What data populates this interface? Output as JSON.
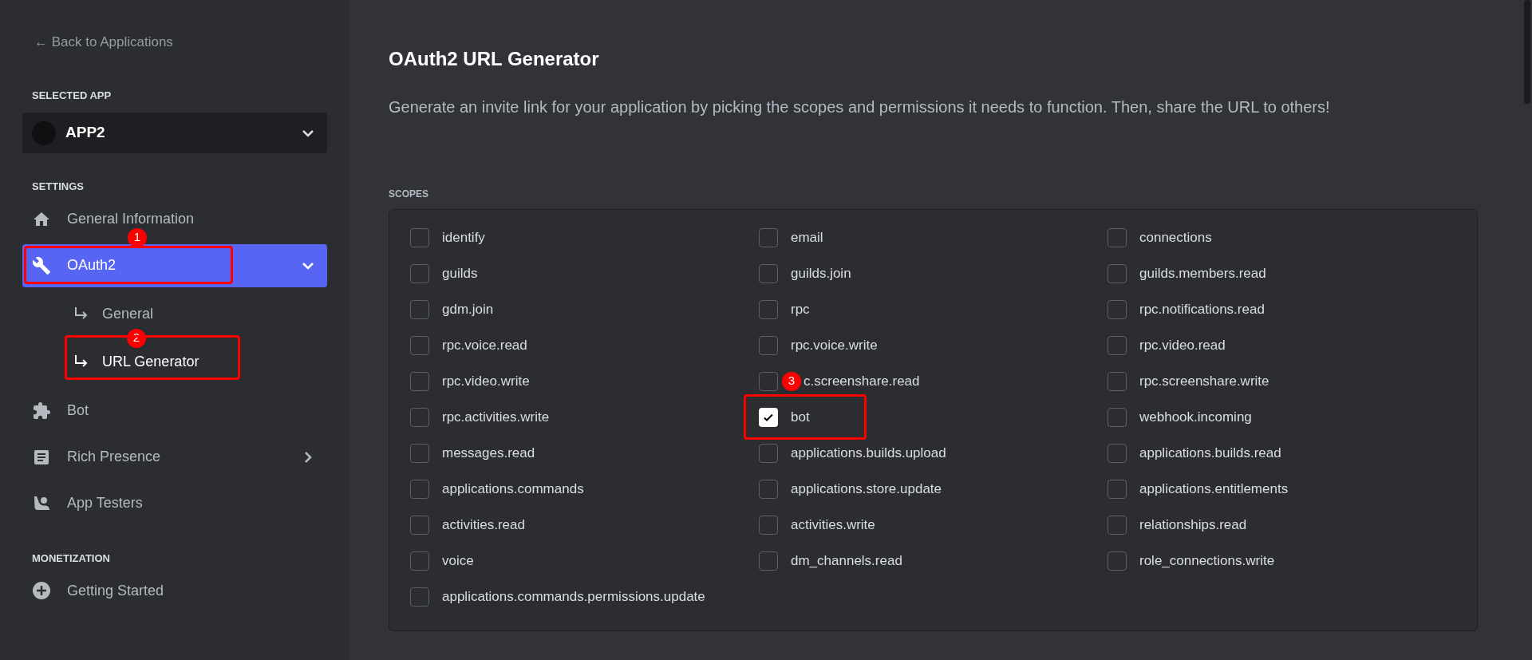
{
  "sidebar": {
    "back_link": "← Back to Applications",
    "selected_app": {
      "heading": "SELECTED APP",
      "name": "APP2"
    },
    "sections": [
      {
        "heading": "SETTINGS",
        "items": [
          {
            "label": "General Information",
            "selected": false
          },
          {
            "label": "OAuth2",
            "selected": true,
            "expanded": true,
            "marker": "1",
            "highlighted": true,
            "children": [
              {
                "label": "General",
                "selected": false
              },
              {
                "label": "URL Generator",
                "selected": true,
                "marker": "2",
                "highlighted": true
              }
            ]
          },
          {
            "label": "Bot",
            "selected": false
          },
          {
            "label": "Rich Presence",
            "selected": false,
            "expanded": false
          },
          {
            "label": "App Testers",
            "selected": false
          }
        ]
      },
      {
        "heading": "MONETIZATION",
        "items": [
          {
            "label": "Getting Started",
            "selected": false
          }
        ]
      }
    ]
  },
  "main": {
    "title": "OAuth2 URL Generator",
    "description": "Generate an invite link for your application by picking the scopes and permissions it needs to function. Then, share the URL to others!"
  },
  "scopes": {
    "heading": "SCOPES",
    "items": [
      {
        "label": "identify",
        "checked": false
      },
      {
        "label": "email",
        "checked": false
      },
      {
        "label": "connections",
        "checked": false
      },
      {
        "label": "guilds",
        "checked": false
      },
      {
        "label": "guilds.join",
        "checked": false
      },
      {
        "label": "guilds.members.read",
        "checked": false
      },
      {
        "label": "gdm.join",
        "checked": false
      },
      {
        "label": "rpc",
        "checked": false
      },
      {
        "label": "rpc.notifications.read",
        "checked": false
      },
      {
        "label": "rpc.voice.read",
        "checked": false
      },
      {
        "label": "rpc.voice.write",
        "checked": false
      },
      {
        "label": "rpc.video.read",
        "checked": false
      },
      {
        "label": "rpc.video.write",
        "checked": false
      },
      {
        "label": "c.screenshare.read",
        "checked": false,
        "marker": "3"
      },
      {
        "label": "rpc.screenshare.write",
        "checked": false
      },
      {
        "label": "rpc.activities.write",
        "checked": false
      },
      {
        "label": "bot",
        "checked": true,
        "highlighted": true
      },
      {
        "label": "webhook.incoming",
        "checked": false
      },
      {
        "label": "messages.read",
        "checked": false
      },
      {
        "label": "applications.builds.upload",
        "checked": false
      },
      {
        "label": "applications.builds.read",
        "checked": false
      },
      {
        "label": "applications.commands",
        "checked": false
      },
      {
        "label": "applications.store.update",
        "checked": false
      },
      {
        "label": "applications.entitlements",
        "checked": false
      },
      {
        "label": "activities.read",
        "checked": false
      },
      {
        "label": "activities.write",
        "checked": false
      },
      {
        "label": "relationships.read",
        "checked": false
      },
      {
        "label": "voice",
        "checked": false
      },
      {
        "label": "dm_channels.read",
        "checked": false
      },
      {
        "label": "role_connections.write",
        "checked": false
      },
      {
        "label": "applications.commands.permissions.update",
        "checked": false
      }
    ]
  }
}
